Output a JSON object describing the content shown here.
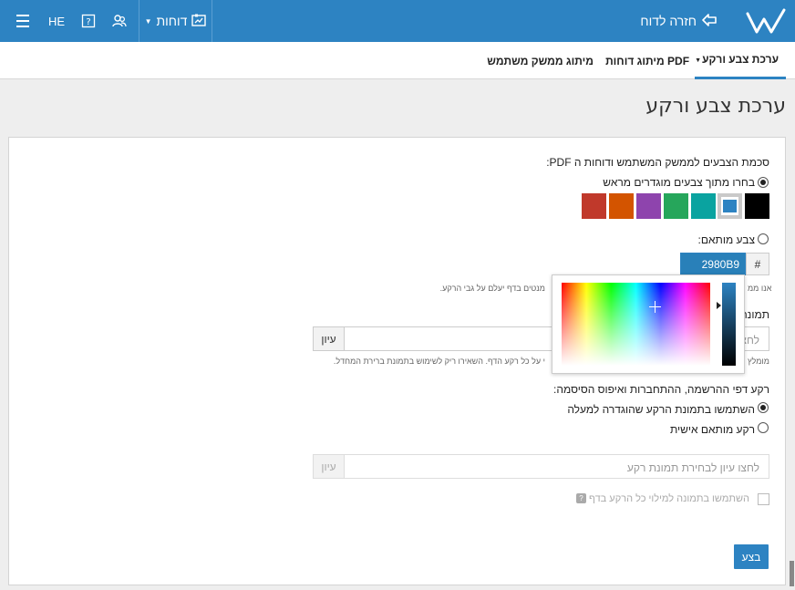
{
  "topbar": {
    "back_label": "חזרה לדוח",
    "reports_label": "דוחות",
    "language": "HE",
    "icons": [
      "logo-w-icon",
      "back-arrow-icon",
      "reports-icon",
      "dropdown-caret-icon",
      "users-icon",
      "help-icon",
      "hamburger-icon"
    ]
  },
  "tabs": [
    {
      "label": "ערכת צבע ורקע",
      "active": true
    },
    {
      "label": "מיתוג דוחות PDF",
      "active": false
    },
    {
      "label": "מיתוג ממשק משתמש",
      "active": false
    }
  ],
  "page": {
    "title": "ערכת צבע ורקע"
  },
  "color_scheme": {
    "heading": "סכמת הצבעים לממשק המשתמש ודוחות ה PDF:",
    "predefined_label": "בחרו מתוך צבעים מוגדרים מראש",
    "predefined_selected": true,
    "swatches": [
      "#000000",
      "#2d83c2",
      "#0aa3a0",
      "#26a65b",
      "#8e44ad",
      "#d35400",
      "#c0392b"
    ],
    "selected_swatch": 1,
    "custom_label": "צבע מותאם:",
    "custom_selected": false,
    "hash": "#",
    "hex_value": "2980B9",
    "hint_left": "אנו ממ",
    "hint_right": "מנטים בדף יעלם על גבי הרקע."
  },
  "background_image": {
    "heading_fragment": "תמונה",
    "input_placeholder": "לחצ",
    "browse_label": "עיון",
    "hint_left": "מומלץ",
    "hint_right": "י על כל רקע הדף. השאירו ריק לשימוש בתמונת ברירת המחדל."
  },
  "login_background": {
    "heading": "רקע דפי ההרשמה, ההתחברות ואיפוס הסיסמה:",
    "option_use_above": "השתמשו בתמונת הרקע שהוגדרה למעלה",
    "option_use_above_selected": true,
    "option_custom": "רקע מותאם אישית",
    "option_custom_selected": false,
    "input_placeholder": "לחצו עיון לבחירת תמונת רקע",
    "browse_label": "עיון",
    "checkbox_label": "השתמשו בתמונה למילוי כל הרקע בדף",
    "checkbox_checked": false
  },
  "actions": {
    "apply_label": "בצע"
  }
}
